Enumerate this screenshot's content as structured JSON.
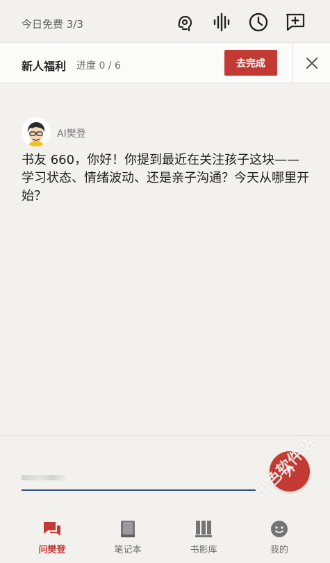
{
  "topbar": {
    "quota_label": "今日免费 3/3",
    "icons": [
      "headset-icon",
      "voice-wave-icon",
      "history-clock-icon",
      "new-chat-icon"
    ]
  },
  "welfare": {
    "title": "新人福利",
    "progress": "进度 0 / 6",
    "action_label": "去完成"
  },
  "chat": {
    "bot_name": "AI樊登",
    "message": "书友 660，你好！你提到最近在关注孩子这块——学习状态、情绪波动、还是亲子沟通？今天从哪里开始？"
  },
  "input": {
    "send_icon": "arrow-up-icon"
  },
  "tabs": [
    {
      "label": "问樊登",
      "icon": "chat-bubbles-icon",
      "active": true
    },
    {
      "label": "笔记本",
      "icon": "notebook-icon",
      "active": false
    },
    {
      "label": "书影库",
      "icon": "library-icon",
      "active": false
    },
    {
      "label": "我的",
      "icon": "profile-icon",
      "active": false
    }
  ],
  "watermark": "出色软件站",
  "colors": {
    "accent": "#c23a33",
    "input_line": "#2d4d86",
    "background": "#f2f1ee"
  }
}
